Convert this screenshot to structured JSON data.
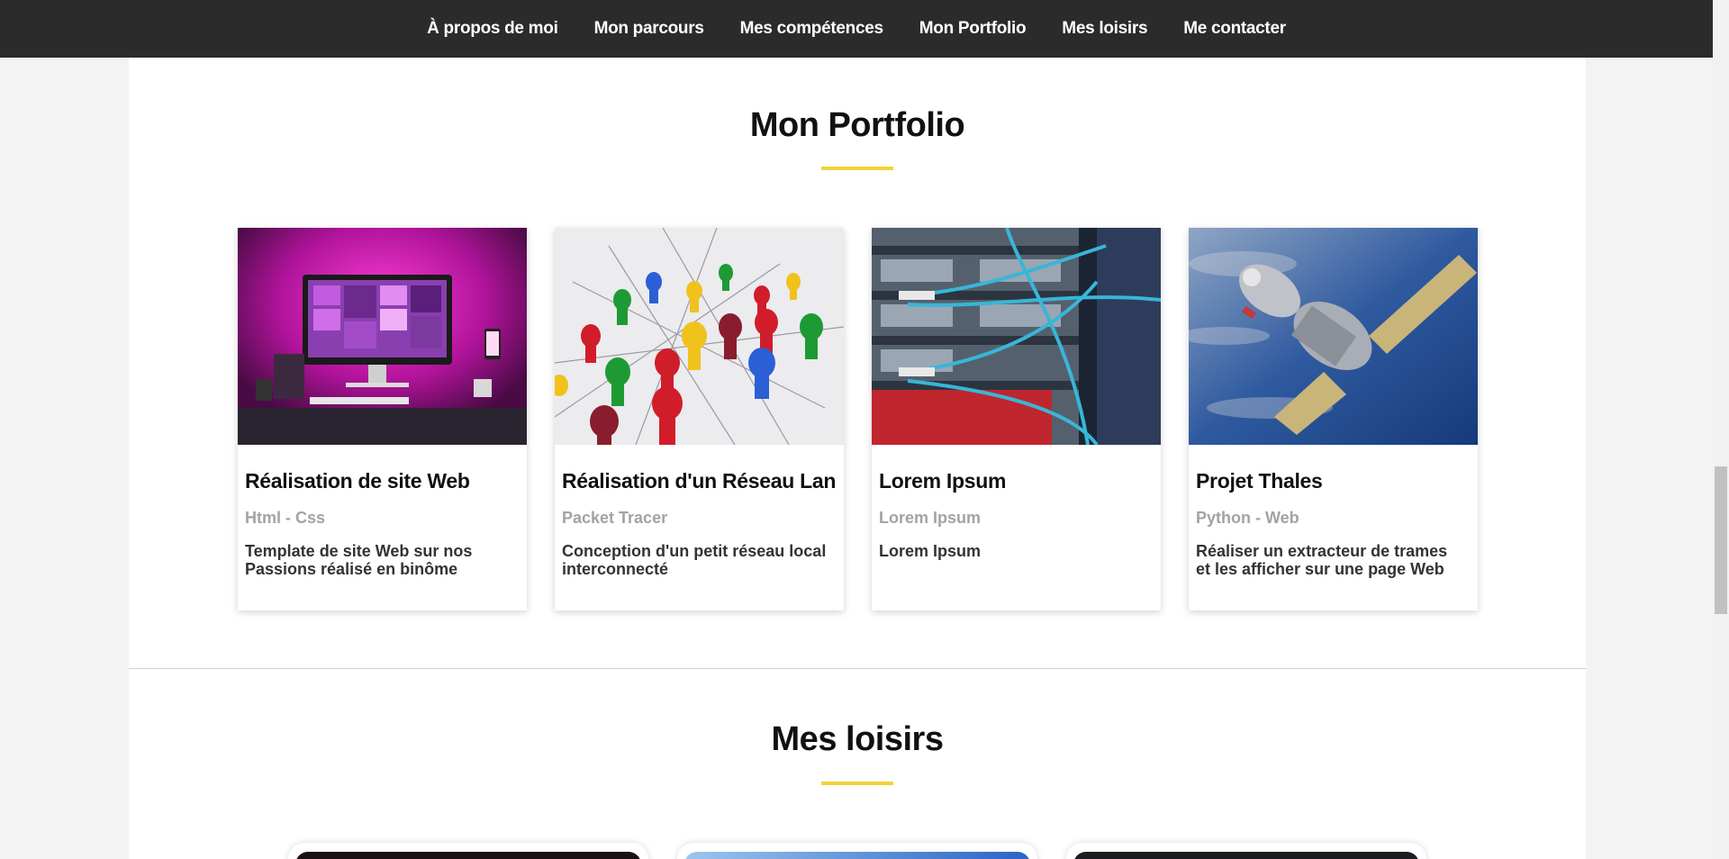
{
  "nav": {
    "items": [
      "À propos de moi",
      "Mon parcours",
      "Mes compétences",
      "Mon Portfolio",
      "Mes loisirs",
      "Me contacter"
    ]
  },
  "portfolio": {
    "title": "Mon Portfolio",
    "cards": [
      {
        "title": "Réalisation de site Web",
        "subtitle": "Html - Css",
        "description": "Template de site Web sur nos Passions réalisé en binôme",
        "image": "desk-computer-neon-image"
      },
      {
        "title": "Réalisation d'un Réseau Lan",
        "subtitle": "Packet Tracer",
        "description": "Conception d'un petit réseau local interconnecté",
        "image": "network-pawns-image"
      },
      {
        "title": "Lorem Ipsum",
        "subtitle": "Lorem Ipsum",
        "description": "Lorem Ipsum",
        "image": "server-cables-image"
      },
      {
        "title": "Projet Thales",
        "subtitle": "Python - Web",
        "description": "Réaliser un extracteur de trames et les afficher sur une page Web",
        "image": "satellite-image"
      }
    ]
  },
  "loisirs": {
    "title": "Mes loisirs"
  },
  "colors": {
    "accent": "#f2d33a",
    "navbar": "#2b2b2b",
    "subtitle": "#a3a3a3"
  }
}
